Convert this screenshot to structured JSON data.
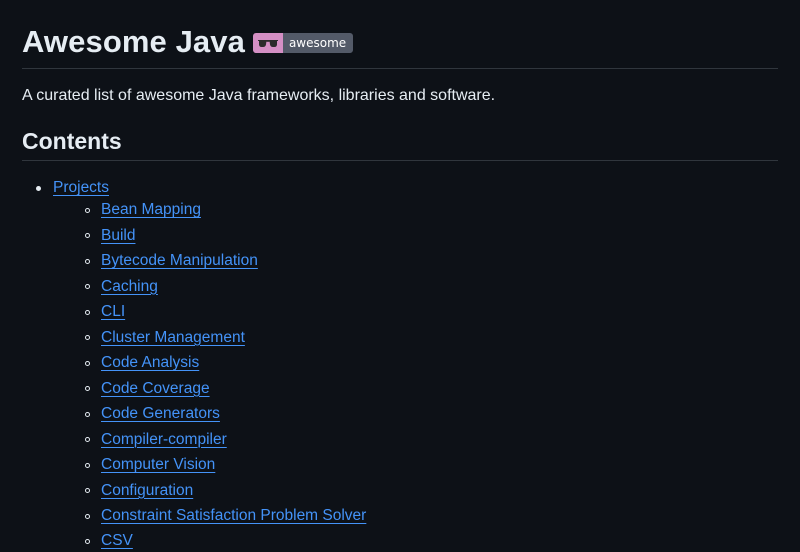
{
  "header": {
    "title": "Awesome Java",
    "badge": {
      "icon": "sunglasses-icon",
      "label": "awesome",
      "left_color": "#d48fc4",
      "right_color": "#535a68"
    }
  },
  "description": "A curated list of awesome Java frameworks, libraries and software.",
  "contents": {
    "heading": "Contents",
    "top_item": "Projects",
    "sub_items": [
      "Bean Mapping",
      "Build",
      "Bytecode Manipulation",
      "Caching",
      "CLI",
      "Cluster Management",
      "Code Analysis",
      "Code Coverage",
      "Code Generators",
      "Compiler-compiler",
      "Computer Vision",
      "Configuration",
      "Constraint Satisfaction Problem Solver",
      "CSV"
    ]
  },
  "colors": {
    "background": "#0d1117",
    "text": "#e6edf3",
    "link": "#4493f8",
    "divider": "#30363d"
  }
}
